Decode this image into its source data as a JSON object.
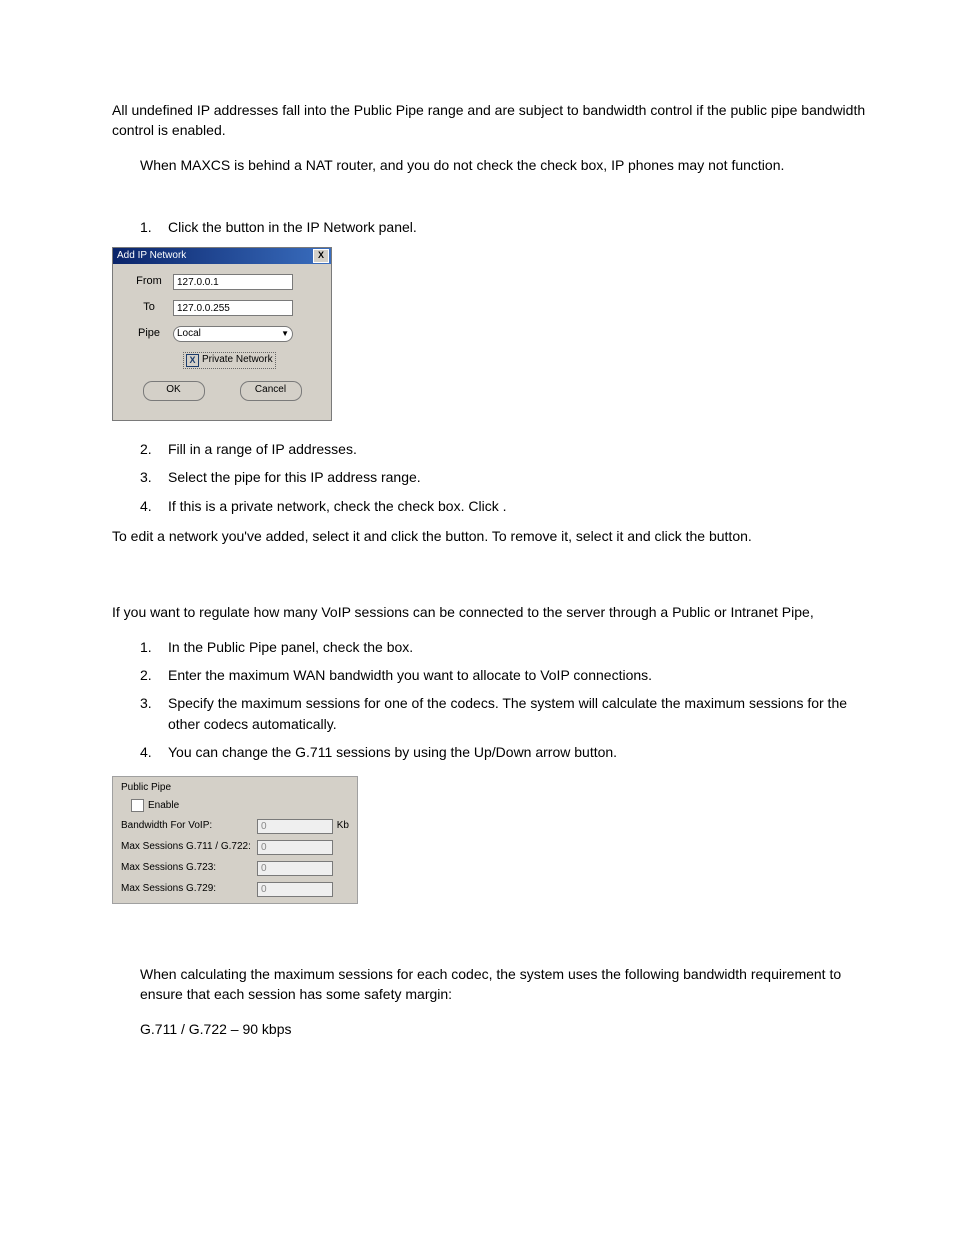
{
  "intro": "All undefined IP addresses fall into the Public Pipe range and are subject to bandwidth control if the public pipe bandwidth control is enabled.",
  "note1a": "When MAXCS is behind a NAT router, and you do not check the ",
  "note1b": " check box, IP phones may not function.",
  "s1n": "1.",
  "s1": "Click the ",
  "s1_after": " button in the IP Network panel.",
  "dlg": {
    "title": "Add IP Network",
    "from_lbl": "From",
    "from_val": "127.0.0.1",
    "to_lbl": "To",
    "to_val": "127.0.0.255",
    "pipe_lbl": "Pipe",
    "pipe_val": "Local",
    "chk_mark": "X",
    "chk_lbl": "Private Network",
    "ok": "OK",
    "cancel": "Cancel"
  },
  "s2n": "2.",
  "s2": "Fill in a range of IP addresses.",
  "s3n": "3.",
  "s3": "Select the pipe for this IP address range.",
  "s4n": "4.",
  "s4a": "If this is a private network, check the ",
  "s4b": " check box. Click ",
  "s4c": ".",
  "edit_a": "To edit a network you've added, select it and click the ",
  "edit_b": " button. To remove it, select it and click the ",
  "edit_c": " button.",
  "bw_intro": "If you want to regulate how many VoIP sessions can be connected to the server through a Public or Intranet Pipe,",
  "b1n": "1.",
  "b1a": "In the Public Pipe panel, check the ",
  "b1b": " box.",
  "b2n": "2.",
  "b2": "Enter the maximum WAN bandwidth you want to allocate to VoIP connections.",
  "b3n": "3.",
  "b3": "Specify the maximum sessions for one of the codecs. The system will calculate the maximum sessions for the other codecs automatically.",
  "b4n": "4.",
  "b4": "You can change the G.711 sessions by using the Up/Down arrow button.",
  "pp": {
    "group": "Public Pipe",
    "enable": "Enable",
    "bw_lbl": "Bandwidth For VoIP:",
    "bw_val": "0",
    "bw_unit": "Kb",
    "r1_lbl": "Max Sessions G.711 / G.722:",
    "r1_val": "0",
    "r2_lbl": "Max Sessions G.723:",
    "r2_val": "0",
    "r3_lbl": "Max Sessions G.729:",
    "r3_val": "0"
  },
  "calc_note": "When calculating the maximum sessions for each codec, the system uses the following bandwidth requirement to ensure that each session has some safety margin:",
  "g711": "G.711 / G.722 – 90 kbps"
}
